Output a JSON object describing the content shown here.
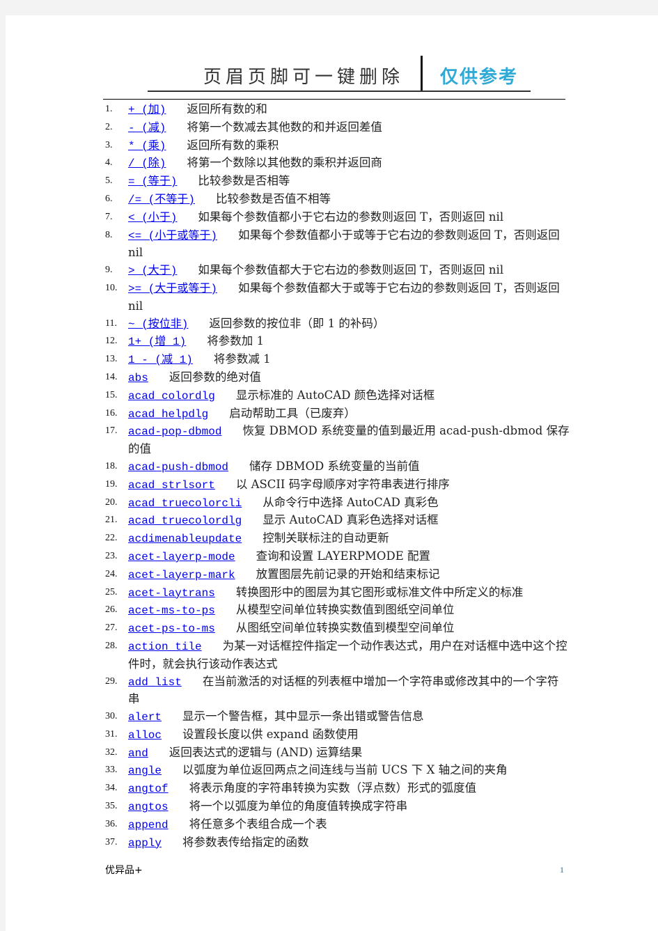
{
  "header": {
    "title": "页眉页脚可一键删除",
    "reference_label": "仅供参考"
  },
  "theme": {
    "link_color": "#0000ee",
    "reference_color": "#2fa9d6"
  },
  "items": [
    {
      "n": "1.",
      "fn": "+ (加)",
      "desc": "返回所有数的和"
    },
    {
      "n": "2.",
      "fn": " - (减)",
      "desc": "将第一个数减去其他数的和并返回差值"
    },
    {
      "n": "3.",
      "fn": "* (乘)",
      "desc": "返回所有数的乘积"
    },
    {
      "n": "4.",
      "fn": "/ (除)",
      "desc": "将第一个数除以其他数的乘积并返回商"
    },
    {
      "n": "5.",
      "fn": "= (等于)",
      "desc": "比较参数是否相等"
    },
    {
      "n": "6.",
      "fn": "/= (不等于)",
      "desc": "比较参数是否值不相等"
    },
    {
      "n": "7.",
      "fn": "< (小于)",
      "desc": "如果每个参数值都小于它右边的参数则返回 T，否则返回 nil"
    },
    {
      "n": "8.",
      "fn": "<= (小于或等于)",
      "desc": "如果每个参数值都小于或等于它右边的参数则返回 T，否则返回 nil"
    },
    {
      "n": "9.",
      "fn": "> (大于)",
      "desc": "如果每个参数值都大于它右边的参数则返回 T，否则返回 nil"
    },
    {
      "n": "10.",
      "fn": ">= (大于或等于)",
      "desc": "如果每个参数值都大于或等于它右边的参数则返回 T，否则返回 nil"
    },
    {
      "n": "11.",
      "fn": "~ (按位非)",
      "desc": "返回参数的按位非（即 1 的补码）"
    },
    {
      "n": "12.",
      "fn": "1+ (增 1)",
      "desc": "将参数加 1"
    },
    {
      "n": "13.",
      "fn": "1 - (减 1)",
      "desc": "将参数减 1"
    },
    {
      "n": "14.",
      "fn": "abs",
      "desc": "返回参数的绝对值"
    },
    {
      "n": "15.",
      "fn": "acad_colordlg",
      "desc": "显示标准的 AutoCAD 颜色选择对话框"
    },
    {
      "n": "16.",
      "fn": "acad_helpdlg",
      "desc": "启动帮助工具（已废弃）"
    },
    {
      "n": "17.",
      "fn": "acad-pop-dbmod",
      "desc": "恢复 DBMOD 系统变量的值到最近用 acad-push-dbmod 保存的值"
    },
    {
      "n": "18.",
      "fn": "acad-push-dbmod",
      "desc": "储存 DBMOD 系统变量的当前值"
    },
    {
      "n": "19.",
      "fn": "acad_strlsort",
      "desc": "以 ASCII 码字母顺序对字符串表进行排序"
    },
    {
      "n": "20.",
      "fn": "acad_truecolorcli",
      "desc": "从命令行中选择 AutoCAD 真彩色"
    },
    {
      "n": "21.",
      "fn": "acad_truecolordlg",
      "desc": "显示 AutoCAD 真彩色选择对话框"
    },
    {
      "n": "22.",
      "fn": "acdimenableupdate",
      "desc": "控制关联标注的自动更新"
    },
    {
      "n": "23.",
      "fn": "acet-layerp-mode",
      "desc": "查询和设置 LAYERPMODE 配置"
    },
    {
      "n": "24.",
      "fn": "acet-layerp-mark",
      "desc": "放置图层先前记录的开始和结束标记"
    },
    {
      "n": "25.",
      "fn": "acet-laytrans",
      "desc": "转换图形中的图层为其它图形或标准文件中所定义的标准"
    },
    {
      "n": "26.",
      "fn": "acet-ms-to-ps",
      "desc": "从模型空间单位转换实数值到图纸空间单位"
    },
    {
      "n": "27.",
      "fn": "acet-ps-to-ms",
      "desc": "从图纸空间单位转换实数值到模型空间单位"
    },
    {
      "n": "28.",
      "fn": "action_tile",
      "desc": "为某一对话框控件指定一个动作表达式，用户在对话框中选中这个控件时，就会执行该动作表达式"
    },
    {
      "n": "29.",
      "fn": "add_list",
      "desc": "在当前激活的对话框的列表框中增加一个字符串或修改其中的一个字符串"
    },
    {
      "n": "30.",
      "fn": "alert",
      "desc": "显示一个警告框，其中显示一条出错或警告信息"
    },
    {
      "n": "31.",
      "fn": "alloc",
      "desc": "设置段长度以供 expand 函数使用"
    },
    {
      "n": "32.",
      "fn": "and",
      "desc": "返回表达式的逻辑与 (AND) 运算结果"
    },
    {
      "n": "33.",
      "fn": "angle",
      "desc": "以弧度为单位返回两点之间连线与当前 UCS 下 X 轴之间的夹角"
    },
    {
      "n": "34.",
      "fn": "angtof",
      "desc": "将表示角度的字符串转换为实数（浮点数）形式的弧度值"
    },
    {
      "n": "35.",
      "fn": "angtos",
      "desc": "将一个以弧度为单位的角度值转换成字符串"
    },
    {
      "n": "36.",
      "fn": "append",
      "desc": "将任意多个表组合成一个表"
    },
    {
      "n": "37.",
      "fn": "apply",
      "desc": "将参数表传给指定的函数"
    }
  ],
  "footer": {
    "left": "优异品+",
    "page_number": "1"
  }
}
